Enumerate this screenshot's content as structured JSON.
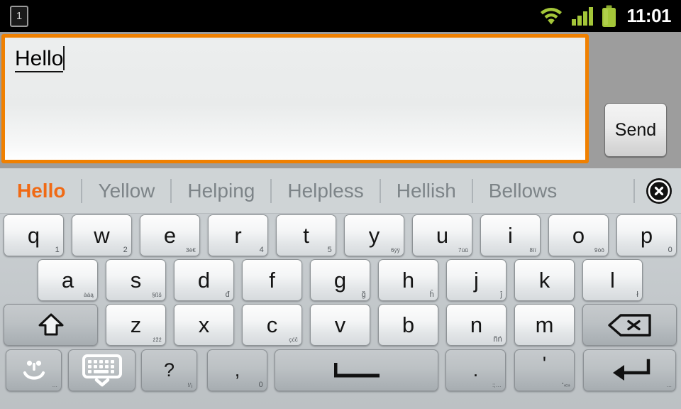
{
  "status_bar": {
    "notification_count": "1",
    "icons": [
      "wifi-icon",
      "signal-icon",
      "battery-icon"
    ],
    "clock": "11:01"
  },
  "compose": {
    "text": "Hello",
    "send_label": "Send",
    "focus_color": "#f08000"
  },
  "suggestions": {
    "active_color": "#f06a15",
    "inactive_color": "#7d8488",
    "items": [
      {
        "label": "Hello",
        "active": true
      },
      {
        "label": "Yellow",
        "active": false
      },
      {
        "label": "Helping",
        "active": false
      },
      {
        "label": "Helpless",
        "active": false
      },
      {
        "label": "Hellish",
        "active": false
      },
      {
        "label": "Bellows",
        "active": false
      }
    ],
    "close_icon": "close-circle-icon"
  },
  "keyboard": {
    "row1": [
      {
        "key": "q",
        "hint": "1"
      },
      {
        "key": "w",
        "hint": "2"
      },
      {
        "key": "e",
        "hint": "3è€"
      },
      {
        "key": "r",
        "hint": "4"
      },
      {
        "key": "t",
        "hint": "5"
      },
      {
        "key": "y",
        "hint": "6ýÿ"
      },
      {
        "key": "u",
        "hint": "7ùû"
      },
      {
        "key": "i",
        "hint": "8ìï"
      },
      {
        "key": "o",
        "hint": "9òô"
      },
      {
        "key": "p",
        "hint": "0"
      }
    ],
    "row2": [
      {
        "key": "a",
        "hint": "àáą"
      },
      {
        "key": "s",
        "hint": "§ßš"
      },
      {
        "key": "d",
        "hint": "đ"
      },
      {
        "key": "f",
        "hint": ""
      },
      {
        "key": "g",
        "hint": "ğ"
      },
      {
        "key": "h",
        "hint": "ĥ"
      },
      {
        "key": "j",
        "hint": "ĵ"
      },
      {
        "key": "k",
        "hint": ""
      },
      {
        "key": "l",
        "hint": "ł"
      }
    ],
    "row3": [
      {
        "key": "shift",
        "icon": "shift-arrow-icon",
        "hint": ""
      },
      {
        "key": "z",
        "hint": "żžź"
      },
      {
        "key": "x",
        "hint": ""
      },
      {
        "key": "c",
        "hint": "çćč"
      },
      {
        "key": "v",
        "hint": ""
      },
      {
        "key": "b",
        "hint": ""
      },
      {
        "key": "n",
        "hint": "ñń"
      },
      {
        "key": "m",
        "hint": ""
      },
      {
        "key": "backspace",
        "icon": "backspace-icon",
        "hint": ""
      }
    ],
    "row4": [
      {
        "key": "emoji",
        "icon": "smiley-icon",
        "hint": "..."
      },
      {
        "key": "hide-keyboard",
        "icon": "keyboard-down-icon",
        "hint": ""
      },
      {
        "key": "?",
        "hint": "!/¡"
      },
      {
        "key": ",",
        "hint": "0"
      },
      {
        "key": "space",
        "icon": "space-icon",
        "hint": ""
      },
      {
        "key": ".",
        "hint": ":;…"
      },
      {
        "key": "'",
        "hint": "\"«»"
      },
      {
        "key": "enter",
        "icon": "enter-icon",
        "hint": "..."
      }
    ]
  }
}
